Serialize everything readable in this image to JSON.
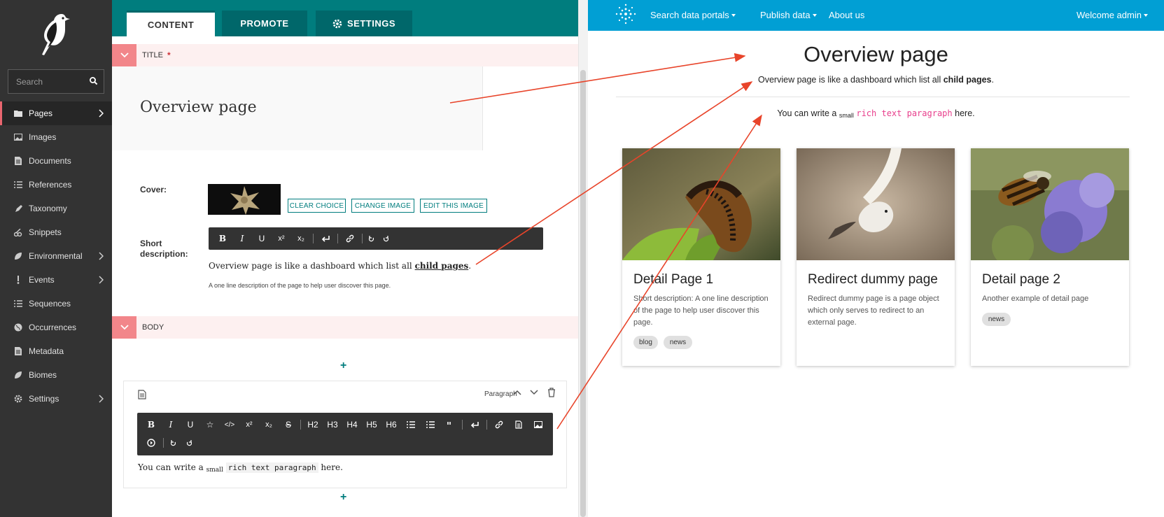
{
  "sidebar": {
    "search_placeholder": "Search",
    "items": [
      {
        "label": "Pages",
        "icon": "folder-icon"
      },
      {
        "label": "Images",
        "icon": "image-icon"
      },
      {
        "label": "Documents",
        "icon": "document-icon"
      },
      {
        "label": "References",
        "icon": "list-icon"
      },
      {
        "label": "Taxonomy",
        "icon": "pen-icon"
      },
      {
        "label": "Snippets",
        "icon": "snippet-icon"
      },
      {
        "label": "Environmental",
        "icon": "leaf-icon"
      },
      {
        "label": "Events",
        "icon": "event-icon"
      },
      {
        "label": "Sequences",
        "icon": "list-icon"
      },
      {
        "label": "Occurrences",
        "icon": "globe-icon"
      },
      {
        "label": "Metadata",
        "icon": "document-icon"
      },
      {
        "label": "Biomes",
        "icon": "leaf-icon"
      },
      {
        "label": "Settings",
        "icon": "gear-icon"
      }
    ]
  },
  "editor": {
    "tabs": [
      "CONTENT",
      "PROMOTE",
      "SETTINGS"
    ],
    "title_section": "TITLE",
    "required_mark": "*",
    "title_value": "Overview page",
    "cover_label": "Cover:",
    "cover_buttons": [
      "CLEAR CHOICE",
      "CHANGE IMAGE",
      "EDIT THIS IMAGE"
    ],
    "short_desc_label": "Short description:",
    "short_desc_toolbar": [
      "B",
      "I",
      "U",
      "x²",
      "x₂"
    ],
    "short_desc_text": "Overview page is like a dashboard which list all",
    "short_desc_link": "child pages",
    "short_desc_end": ".",
    "short_desc_help": "A one line description of the page to help user discover this page.",
    "body_section": "BODY",
    "plus_top": "+",
    "plus_bottom": "+",
    "block_type": "Paragraph",
    "body_toolbar": [
      "B",
      "I",
      "U",
      "☆",
      "</>",
      "x²",
      "x₂",
      "S",
      "H2",
      "H3",
      "H4",
      "H5",
      "H6"
    ],
    "body_text_a": "You can write a",
    "body_text_small": "small",
    "body_text_code": "rich text paragraph",
    "body_text_end": "here."
  },
  "site": {
    "nav": [
      "Search data portals",
      "Publish data",
      "About us"
    ],
    "welcome": "Welcome admin",
    "page_title": "Overview page",
    "page_desc": "Overview page is like a dashboard which list all",
    "page_desc_bold": "child pages",
    "page_desc_end": ".",
    "para_a": "You can write a",
    "para_small": "small",
    "para_code": "rich text paragraph",
    "para_end": "here.",
    "cards": [
      {
        "title": "Detail Page 1",
        "desc": "Short description: A one line description of the page to help user discover this page.",
        "tags": [
          "blog",
          "news"
        ]
      },
      {
        "title": "Redirect dummy page",
        "desc": "Redirect dummy page is a page object which only serves to redirect to an external page.",
        "tags": []
      },
      {
        "title": "Detail page 2",
        "desc": "Another example of detail page",
        "tags": [
          "news"
        ]
      }
    ]
  },
  "colors": {
    "sidebar": "#333333",
    "teal": "#007d7e",
    "nav": "#019fd4",
    "arrow": "#e8442a",
    "section_toggle": "#f2868a"
  }
}
